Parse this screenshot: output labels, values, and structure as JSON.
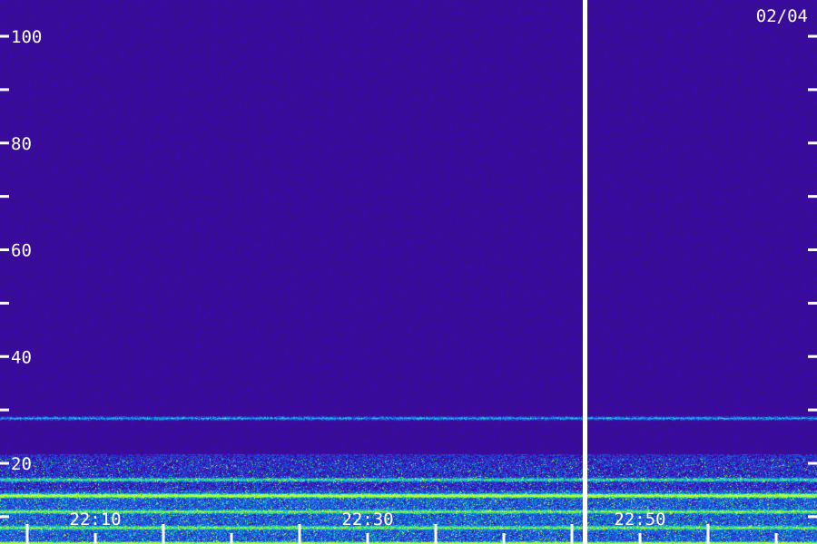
{
  "chart_data": {
    "type": "heatmap",
    "title": "",
    "date_label": "02/04",
    "xlabel": "",
    "ylabel": "",
    "x_ticks": [
      "22:10",
      "22:30",
      "22:50"
    ],
    "y_ticks": [
      "20",
      "40",
      "60",
      "80",
      "100"
    ],
    "ylim": [
      0,
      105
    ],
    "xlim": [
      "22:03",
      "23:03"
    ],
    "data_gap_time": "22:46",
    "colormap": [
      "#2a0a6b",
      "#3a14a0",
      "#2050d8",
      "#10a8e0",
      "#40e070",
      "#b0ff40"
    ],
    "background_color": "#2f0d7d",
    "bands": [
      {
        "y": 28.5,
        "strength": "medium"
      },
      {
        "y": 17,
        "strength": "medium"
      },
      {
        "y": 14,
        "strength": "high"
      },
      {
        "y": 11,
        "strength": "medium"
      },
      {
        "y": 8,
        "strength": "medium"
      },
      {
        "y": 5,
        "strength": "high"
      }
    ]
  }
}
